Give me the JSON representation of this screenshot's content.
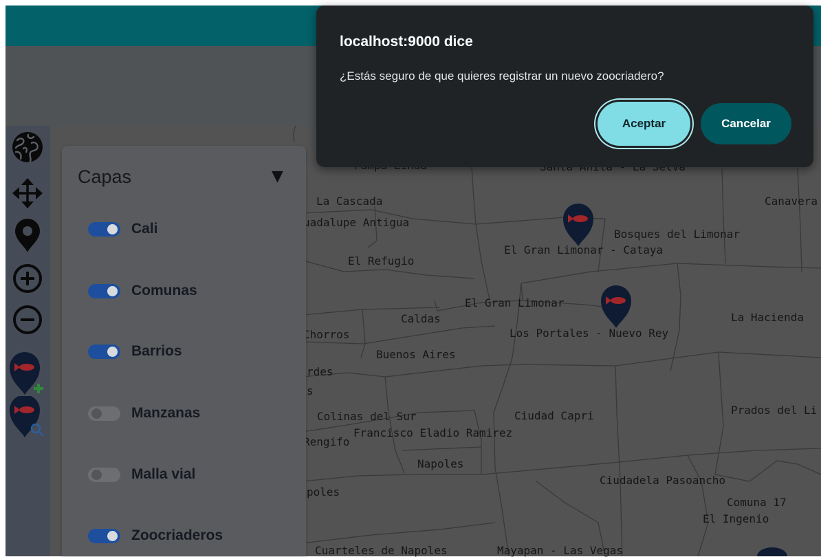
{
  "colors": {
    "header_bar": "#03616a",
    "subheader": "#505356",
    "toolbar_bg": "#464c57",
    "map_bg": "#535353",
    "panel_bg": "#5a5b5e",
    "toggle_on": "#1d4f9e",
    "toggle_off": "#6d6e71",
    "marker": "#0e1b33",
    "marker_fish": "#a3262a",
    "dialog_bg": "#1f2326",
    "accept_bg": "#80dde6",
    "cancel_bg": "#00585e"
  },
  "toolbar": {
    "tools": [
      {
        "icon": "globe-icon"
      },
      {
        "icon": "move-icon"
      },
      {
        "icon": "location-pin-icon"
      },
      {
        "icon": "zoom-in-icon"
      },
      {
        "icon": "zoom-out-icon"
      },
      {
        "icon": "add-zoocriadero-icon"
      },
      {
        "icon": "search-zoocriadero-icon"
      }
    ]
  },
  "layers_panel": {
    "title": "Capas",
    "collapse_glyph": "▼",
    "layers": [
      {
        "label": "Cali",
        "enabled": true
      },
      {
        "label": "Comunas",
        "enabled": true
      },
      {
        "label": "Barrios",
        "enabled": true
      },
      {
        "label": "Manzanas",
        "enabled": false
      },
      {
        "label": "Malla vial",
        "enabled": false
      },
      {
        "label": "Zoocriaderos",
        "enabled": true
      }
    ]
  },
  "map": {
    "marker_icon": "fish-marker-icon",
    "labels": [
      "Pampa Linda",
      "Santa Anita - La Selva",
      "La Cascada",
      "uadalupe Antigua",
      "El Refugio",
      "El Gran Limonar - Cataya",
      "Bosques del Limonar",
      "Canavera",
      "El Gran Limonar",
      "Caldas",
      "Chorros",
      "Los Portales - Nuevo Rey",
      "La Hacienda",
      "Buenos Aires",
      "rdes",
      "s",
      "Colinas del Sur",
      "Francisco Eladio Ramirez",
      "Rengifo",
      "Ciudad Capri",
      "Prados del Li",
      "Napoles",
      "Ciudadela Pasoancho",
      "poles",
      "Comuna 17",
      "El Ingenio",
      "Cuarteles de Napoles",
      "Mayapan - Las Vegas"
    ]
  },
  "dialog": {
    "title": "localhost:9000 dice",
    "message": "¿Estás seguro de que quieres registrar un nuevo zoocriadero?",
    "accept_label": "Aceptar",
    "cancel_label": "Cancelar"
  }
}
